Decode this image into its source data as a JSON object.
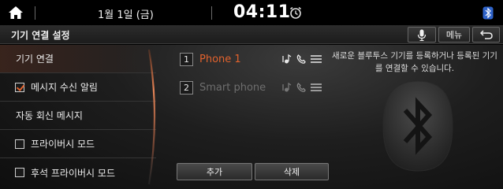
{
  "status": {
    "date": "1월 1일 (금)",
    "time": "04:11"
  },
  "header": {
    "title": "기기 연결 설정",
    "menu_label": "메뉴"
  },
  "sidebar": {
    "items": [
      {
        "label": "기기 연결",
        "checkbox": null,
        "active": true
      },
      {
        "label": "메시지 수신 알림",
        "checkbox": true,
        "active": false
      },
      {
        "label": "자동 회신 메시지",
        "checkbox": null,
        "active": false
      },
      {
        "label": "프라이버시 모드",
        "checkbox": false,
        "active": false
      },
      {
        "label": "후석 프라이버시 모드",
        "checkbox": false,
        "active": false
      }
    ]
  },
  "devices": [
    {
      "number": "1",
      "name": "Phone 1",
      "connected": true
    },
    {
      "number": "2",
      "name": "Smart phone",
      "connected": false
    }
  ],
  "buttons": {
    "add": "추가",
    "delete": "삭제"
  },
  "info": {
    "message": "새로운 블루투스 기기를 등록하거나 등록된 기기를 연결할 수 있습니다."
  },
  "colors": {
    "accent": "#e2622d",
    "inactive_text": "#6e6e6e"
  },
  "icons": [
    "home-icon",
    "alarm-icon",
    "bluetooth-status-icon",
    "microphone-icon",
    "back-icon",
    "audio-icon",
    "phone-icon",
    "drag-handle-icon",
    "bluetooth-icon"
  ]
}
